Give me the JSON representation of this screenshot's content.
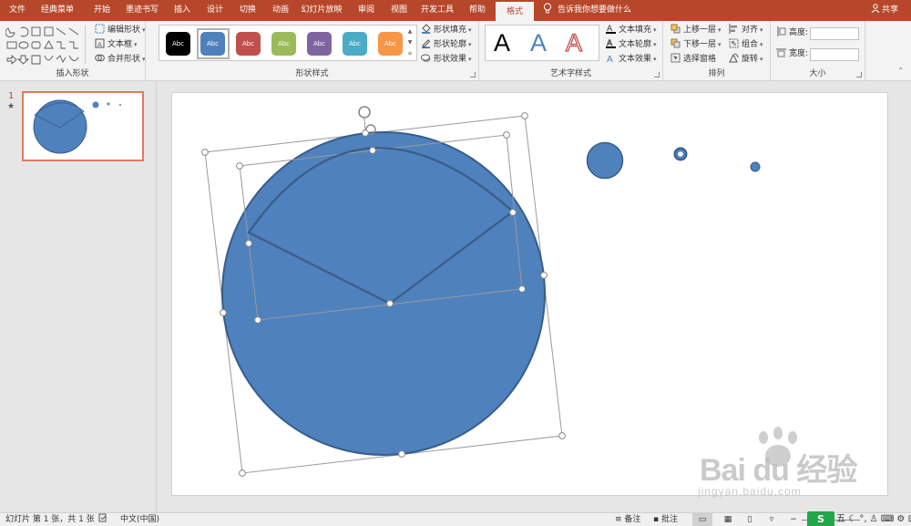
{
  "tabs": [
    {
      "label": "文件",
      "active": false
    },
    {
      "label": "经典菜单",
      "active": false
    },
    {
      "label": "开始",
      "active": false
    },
    {
      "label": "墨迹书写",
      "active": false
    },
    {
      "label": "插入",
      "active": false
    },
    {
      "label": "设计",
      "active": false
    },
    {
      "label": "切换",
      "active": false
    },
    {
      "label": "动画",
      "active": false
    },
    {
      "label": "幻灯片放映",
      "active": false
    },
    {
      "label": "审阅",
      "active": false
    },
    {
      "label": "视图",
      "active": false
    },
    {
      "label": "开发工具",
      "active": false
    },
    {
      "label": "帮助",
      "active": false
    },
    {
      "label": "格式",
      "active": true
    }
  ],
  "tell_me": "告诉我你想要做什么",
  "share": "共享",
  "groups": {
    "insert_shapes": {
      "label": "插入形状",
      "edit_shape": "编辑形状",
      "text_box": "文本框",
      "merge_shapes": "合并形状"
    },
    "shape_styles": {
      "label": "形状样式",
      "swatch_text": "Abc",
      "swatch_colors": [
        "#000000",
        "#4f81bd",
        "#c0504d",
        "#9bbb59",
        "#8064a2",
        "#4bacc6",
        "#f79646"
      ],
      "fill": "形状填充",
      "outline": "形状轮廓",
      "effects": "形状效果"
    },
    "wordart": {
      "label": "艺术字样式",
      "letter": "A",
      "text_fill": "文本填充",
      "text_outline": "文本轮廓",
      "text_effects": "文本效果"
    },
    "arrange": {
      "label": "排列",
      "bring_forward": "上移一层",
      "send_backward": "下移一层",
      "selection_pane": "选择窗格",
      "align": "对齐",
      "group": "组合",
      "rotate": "旋转"
    },
    "size": {
      "label": "大小",
      "height_label": "高度:",
      "width_label": "宽度:",
      "height_value": "",
      "width_value": ""
    }
  },
  "slides_pane": {
    "slide_number": "1",
    "animation_marker": "★"
  },
  "colors": {
    "accent": "#b7472a",
    "shape_fill": "#4f81bd",
    "shape_stroke": "#385d8a"
  },
  "status": {
    "slide_info": "幻灯片 第 1 张，共 1 张",
    "language": "中文(中国)",
    "notes": "备注",
    "comments": "批注"
  },
  "watermark": {
    "brand": "Bai du 经验",
    "url": "jingyan.baidu.com"
  }
}
